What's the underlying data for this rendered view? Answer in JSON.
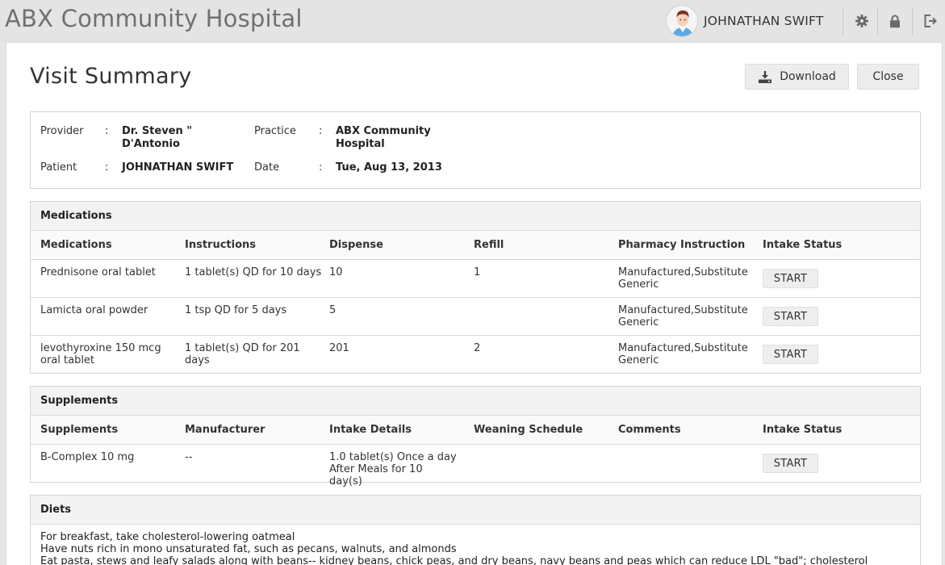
{
  "app": {
    "title": "ABX Community Hospital"
  },
  "user": {
    "name": "JOHNATHAN SWIFT"
  },
  "icons": {
    "avatar": "avatar-icon",
    "settings": "gear-icon",
    "lock": "lock-icon",
    "logout": "logout-icon",
    "download": "download-icon"
  },
  "page": {
    "title": "Visit Summary",
    "download_label": "Download",
    "close_label": "Close"
  },
  "info": {
    "provider_label": "Provider",
    "provider_value": "Dr. Steven \" D'Antonio",
    "practice_label": "Practice",
    "practice_value": "ABX Community Hospital",
    "patient_label": "Patient",
    "patient_value": "JOHNATHAN SWIFT",
    "date_label": "Date",
    "date_value": "Tue, Aug 13, 2013",
    "separator": ":"
  },
  "medications": {
    "title": "Medications",
    "columns": [
      "Medications",
      "Instructions",
      "Dispense",
      "Refill",
      "Pharmacy Instruction",
      "Intake Status"
    ],
    "rows": [
      {
        "name": "Prednisone oral tablet",
        "instructions": "1 tablet(s) QD for 10 days",
        "dispense": "10",
        "refill": "1",
        "pharmacy": "Manufactured,Substitute Generic",
        "status": "START"
      },
      {
        "name": "Lamicta oral powder",
        "instructions": "1 tsp QD for 5 days",
        "dispense": "5",
        "refill": "",
        "pharmacy": "Manufactured,Substitute Generic",
        "status": "START"
      },
      {
        "name": "levothyroxine 150 mcg oral tablet",
        "instructions": "1 tablet(s) QD for 201 days",
        "dispense": "201",
        "refill": "2",
        "pharmacy": "Manufactured,Substitute Generic",
        "status": "START"
      }
    ]
  },
  "supplements": {
    "title": "Supplements",
    "columns": [
      "Supplements",
      "Manufacturer",
      "Intake Details",
      "Weaning Schedule",
      "Comments",
      "Intake Status"
    ],
    "rows": [
      {
        "name": "B-Complex 10 mg",
        "manufacturer": "--",
        "intake_details": "1.0 tablet(s) Once a day After Meals for 10 day(s)",
        "weaning": "",
        "comments": "",
        "status": "START"
      }
    ]
  },
  "diets": {
    "title": "Diets",
    "lines": [
      "For breakfast, take cholesterol-lowering oatmeal",
      "Have nuts rich in mono unsaturated fat, such as pecans, walnuts, and almonds",
      "Eat pasta, stews and leafy salads along with beans-- kidney beans, chick peas, and dry beans, navy beans and peas which can reduce LDL \"bad\"; cholesterol"
    ]
  },
  "colors": {
    "background": "#e6e6e6",
    "panel": "#ffffff",
    "section_header": "#f3f3f3",
    "button": "#ededed",
    "border": "#d5d5d5",
    "app_title": "#707070"
  }
}
